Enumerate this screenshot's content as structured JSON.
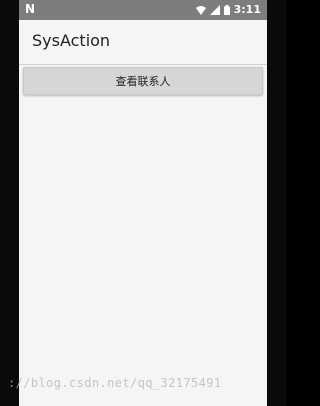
{
  "status_bar": {
    "left_icon": "notification-n-icon",
    "time": "3:11",
    "icons": [
      "wifi-icon",
      "signal-icon",
      "battery-icon"
    ]
  },
  "app_bar": {
    "title": "SysAction"
  },
  "main": {
    "button_label": "查看联系人"
  },
  "watermark": {
    "text": "://blog.csdn.net/qq_32175491"
  },
  "colors": {
    "status_bar": "#7d7d7d",
    "background": "#f5f5f5",
    "button": "#d6d6d6"
  }
}
